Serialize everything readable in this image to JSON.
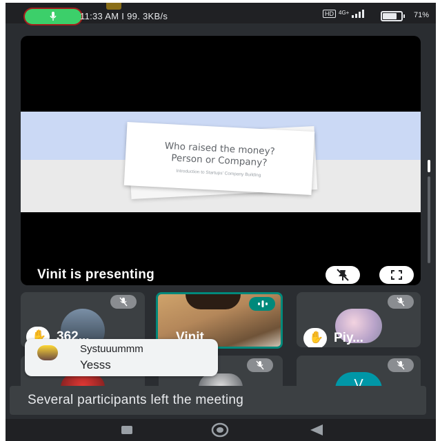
{
  "status_bar": {
    "time": "11:33 AM",
    "speed": "99. 3KB/s",
    "signal": "4G+",
    "battery": "71%",
    "battery_level": 0.71
  },
  "stage": {
    "slide_question": "Who raised the money? Person or Company?",
    "slide_line1": "Who raised the money?",
    "slide_line2": "Person or Company?",
    "slide_subtitle": "Introduction to Startups' Company Building",
    "presenter_label": "Vinit is presenting",
    "unpin_icon": "pin-off-icon",
    "fullscreen_icon": "fullscreen-icon"
  },
  "participants": [
    {
      "name": "362...",
      "muted": true,
      "hand_raised": true
    },
    {
      "name": "Vinit",
      "speaking": true
    },
    {
      "name": "Piy...",
      "muted": true,
      "hand_raised": true
    },
    {
      "name": "",
      "muted": false
    },
    {
      "name": "",
      "muted": true
    },
    {
      "name": "",
      "initial": "V",
      "muted": true
    }
  ],
  "chat_toast": {
    "sender": "Systuuummm",
    "message": "Yesss"
  },
  "snackbar": {
    "text": "Several participants left the meeting"
  },
  "colors": {
    "mic_active": "#3ccf6a",
    "speaking_border": "#00897b",
    "tile_bg": "#3c4043",
    "avatar_v": "#0097a7"
  },
  "nav": {
    "recents_icon": "recents-icon",
    "home_icon": "home-icon",
    "back_icon": "back-icon"
  }
}
